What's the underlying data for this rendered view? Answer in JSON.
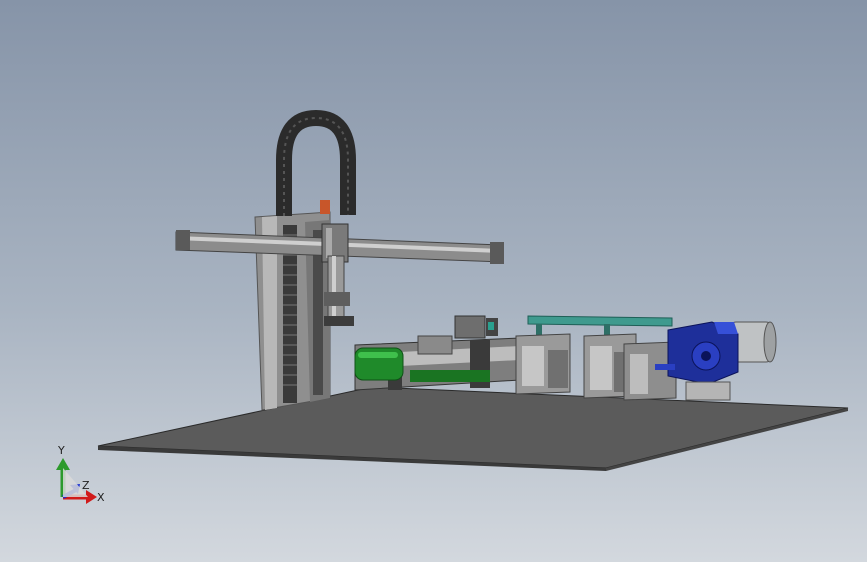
{
  "viewport": {
    "background_top": "#8694a8",
    "background_bottom": "#d3d8de"
  },
  "triad": {
    "x_label": "X",
    "y_label": "Y",
    "z_label": "Z",
    "x_color": "#d11a1a",
    "y_color": "#2c9a2c",
    "z_color": "#1a2fd1"
  },
  "parts": {
    "base_plate_color": "#5b5b5b",
    "aluminum_color": "#9a9a9a",
    "cable_chain_color": "#2b2b2b",
    "motor_housing_color": "#1e2f9a",
    "motor_body_color": "#bfc2c4",
    "cylinder_color": "#1f8a2a",
    "rail_color": "#3f9a8e"
  }
}
